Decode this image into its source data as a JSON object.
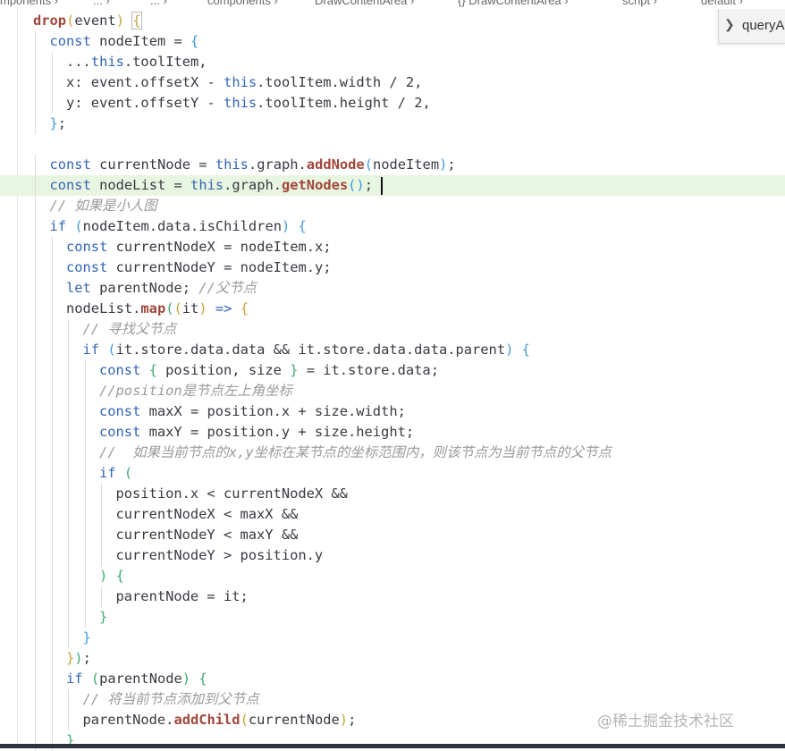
{
  "breadcrumb": {
    "items": [
      "mponents",
      "...",
      "...",
      "components",
      "DrawContentArea",
      "{} DrawContentArea",
      "script",
      "default"
    ]
  },
  "find_widget": {
    "toggle_icon": "chevron-right",
    "input_value": "queryA"
  },
  "watermark": {
    "text": "@稀土掘金技术社区"
  },
  "colors": {
    "keyword": "#3465b5",
    "function": "#a0463b",
    "comment": "#9a9a9a",
    "bracket_1": "#c7a43b",
    "bracket_2": "#3f9cdc",
    "bracket_3": "#3eaa72",
    "current_line": "#e8f5e0"
  },
  "editor": {
    "current_line_index": 8,
    "lines": [
      {
        "indent": 0,
        "tokens": [
          {
            "t": "drop",
            "c": "fn"
          },
          {
            "t": "(",
            "c": "br1"
          },
          {
            "t": "event",
            "c": "id"
          },
          {
            "t": ")",
            "c": "br1"
          },
          {
            "t": " ",
            "c": "id"
          },
          {
            "t": "{",
            "c": "br1 sel-bracket"
          }
        ]
      },
      {
        "indent": 1,
        "tokens": [
          {
            "t": "const ",
            "c": "kw"
          },
          {
            "t": "nodeItem = ",
            "c": "id"
          },
          {
            "t": "{",
            "c": "br2"
          }
        ]
      },
      {
        "indent": 2,
        "tokens": [
          {
            "t": "...",
            "c": "id"
          },
          {
            "t": "this",
            "c": "kw"
          },
          {
            "t": ".toolItem,",
            "c": "id"
          }
        ]
      },
      {
        "indent": 2,
        "tokens": [
          {
            "t": "x: event.offsetX - ",
            "c": "id"
          },
          {
            "t": "this",
            "c": "kw"
          },
          {
            "t": ".toolItem.width / 2,",
            "c": "id"
          }
        ]
      },
      {
        "indent": 2,
        "tokens": [
          {
            "t": "y: event.offsetY - ",
            "c": "id"
          },
          {
            "t": "this",
            "c": "kw"
          },
          {
            "t": ".toolItem.height / 2,",
            "c": "id"
          }
        ]
      },
      {
        "indent": 1,
        "tokens": [
          {
            "t": "}",
            "c": "br2"
          },
          {
            "t": ";",
            "c": "id"
          }
        ]
      },
      {
        "indent": 0,
        "tokens": []
      },
      {
        "indent": 1,
        "tokens": [
          {
            "t": "const ",
            "c": "kw"
          },
          {
            "t": "currentNode = ",
            "c": "id"
          },
          {
            "t": "this",
            "c": "kw"
          },
          {
            "t": ".graph.",
            "c": "id"
          },
          {
            "t": "addNode",
            "c": "fn"
          },
          {
            "t": "(",
            "c": "br2"
          },
          {
            "t": "nodeItem",
            "c": "id"
          },
          {
            "t": ")",
            "c": "br2"
          },
          {
            "t": ";",
            "c": "id"
          }
        ]
      },
      {
        "indent": 1,
        "tokens": [
          {
            "t": "const ",
            "c": "kw"
          },
          {
            "t": "nodeList = ",
            "c": "id"
          },
          {
            "t": "this",
            "c": "kw"
          },
          {
            "t": ".graph.",
            "c": "id"
          },
          {
            "t": "getNodes",
            "c": "fn"
          },
          {
            "t": "()",
            "c": "br2"
          },
          {
            "t": ";",
            "c": "id"
          }
        ]
      },
      {
        "indent": 1,
        "tokens": [
          {
            "t": "// 如果是小人图",
            "c": "cm"
          }
        ]
      },
      {
        "indent": 1,
        "tokens": [
          {
            "t": "if ",
            "c": "kw"
          },
          {
            "t": "(",
            "c": "br2"
          },
          {
            "t": "nodeItem.data.isChildren",
            "c": "id"
          },
          {
            "t": ")",
            "c": "br2"
          },
          {
            "t": " ",
            "c": "id"
          },
          {
            "t": "{",
            "c": "br2"
          }
        ]
      },
      {
        "indent": 2,
        "tokens": [
          {
            "t": "const ",
            "c": "kw"
          },
          {
            "t": "currentNodeX = nodeItem.x;",
            "c": "id"
          }
        ]
      },
      {
        "indent": 2,
        "tokens": [
          {
            "t": "const ",
            "c": "kw"
          },
          {
            "t": "currentNodeY = nodeItem.y;",
            "c": "id"
          }
        ]
      },
      {
        "indent": 2,
        "tokens": [
          {
            "t": "let ",
            "c": "kw"
          },
          {
            "t": "parentNode; ",
            "c": "id"
          },
          {
            "t": "//父节点",
            "c": "cm"
          }
        ]
      },
      {
        "indent": 2,
        "tokens": [
          {
            "t": "nodeList.",
            "c": "id"
          },
          {
            "t": "map",
            "c": "fn"
          },
          {
            "t": "(",
            "c": "br3"
          },
          {
            "t": "(",
            "c": "br1"
          },
          {
            "t": "it",
            "c": "id"
          },
          {
            "t": ")",
            "c": "br1"
          },
          {
            "t": " => ",
            "c": "kw"
          },
          {
            "t": "{",
            "c": "br1"
          }
        ]
      },
      {
        "indent": 3,
        "tokens": [
          {
            "t": "// 寻找父节点",
            "c": "cm"
          }
        ]
      },
      {
        "indent": 3,
        "tokens": [
          {
            "t": "if ",
            "c": "kw"
          },
          {
            "t": "(",
            "c": "br2"
          },
          {
            "t": "it.store.data.data && it.store.data.data.parent",
            "c": "id"
          },
          {
            "t": ")",
            "c": "br2"
          },
          {
            "t": " ",
            "c": "id"
          },
          {
            "t": "{",
            "c": "br2"
          }
        ]
      },
      {
        "indent": 4,
        "tokens": [
          {
            "t": "const ",
            "c": "kw"
          },
          {
            "t": "{",
            "c": "br3"
          },
          {
            "t": " position, size ",
            "c": "id"
          },
          {
            "t": "}",
            "c": "br3"
          },
          {
            "t": " = it.store.data;",
            "c": "id"
          }
        ]
      },
      {
        "indent": 4,
        "tokens": [
          {
            "t": "//position是节点左上角坐标",
            "c": "cm"
          }
        ]
      },
      {
        "indent": 4,
        "tokens": [
          {
            "t": "const ",
            "c": "kw"
          },
          {
            "t": "maxX = position.x + size.width;",
            "c": "id"
          }
        ]
      },
      {
        "indent": 4,
        "tokens": [
          {
            "t": "const ",
            "c": "kw"
          },
          {
            "t": "maxY = position.y + size.height;",
            "c": "id"
          }
        ]
      },
      {
        "indent": 4,
        "tokens": [
          {
            "t": "//  如果当前节点的x,y坐标在某节点的坐标范围内，则该节点为当前节点的父节点",
            "c": "cm"
          }
        ]
      },
      {
        "indent": 4,
        "tokens": [
          {
            "t": "if ",
            "c": "kw"
          },
          {
            "t": "(",
            "c": "br3"
          }
        ]
      },
      {
        "indent": 5,
        "tokens": [
          {
            "t": "position.x < currentNodeX &&",
            "c": "id"
          }
        ]
      },
      {
        "indent": 5,
        "tokens": [
          {
            "t": "currentNodeX < maxX &&",
            "c": "id"
          }
        ]
      },
      {
        "indent": 5,
        "tokens": [
          {
            "t": "currentNodeY < maxY &&",
            "c": "id"
          }
        ]
      },
      {
        "indent": 5,
        "tokens": [
          {
            "t": "currentNodeY > position.y",
            "c": "id"
          }
        ]
      },
      {
        "indent": 4,
        "tokens": [
          {
            "t": ")",
            "c": "br3"
          },
          {
            "t": " ",
            "c": "id"
          },
          {
            "t": "{",
            "c": "br3"
          }
        ]
      },
      {
        "indent": 5,
        "tokens": [
          {
            "t": "parentNode = it;",
            "c": "id"
          }
        ]
      },
      {
        "indent": 4,
        "tokens": [
          {
            "t": "}",
            "c": "br3"
          }
        ]
      },
      {
        "indent": 3,
        "tokens": [
          {
            "t": "}",
            "c": "br2"
          }
        ]
      },
      {
        "indent": 2,
        "tokens": [
          {
            "t": "}",
            "c": "br1"
          },
          {
            "t": ")",
            "c": "br3"
          },
          {
            "t": ";",
            "c": "id"
          }
        ]
      },
      {
        "indent": 2,
        "tokens": [
          {
            "t": "if ",
            "c": "kw"
          },
          {
            "t": "(",
            "c": "br3"
          },
          {
            "t": "parentNode",
            "c": "id"
          },
          {
            "t": ")",
            "c": "br3"
          },
          {
            "t": " ",
            "c": "id"
          },
          {
            "t": "{",
            "c": "br3"
          }
        ]
      },
      {
        "indent": 3,
        "tokens": [
          {
            "t": "// 将当前节点添加到父节点",
            "c": "cm"
          }
        ]
      },
      {
        "indent": 3,
        "tokens": [
          {
            "t": "parentNode.",
            "c": "id"
          },
          {
            "t": "addChild",
            "c": "fn"
          },
          {
            "t": "(",
            "c": "br1"
          },
          {
            "t": "currentNode",
            "c": "id"
          },
          {
            "t": ")",
            "c": "br1"
          },
          {
            "t": ";",
            "c": "id"
          }
        ]
      },
      {
        "indent": 2,
        "tokens": [
          {
            "t": "}",
            "c": "br3"
          }
        ]
      }
    ]
  }
}
